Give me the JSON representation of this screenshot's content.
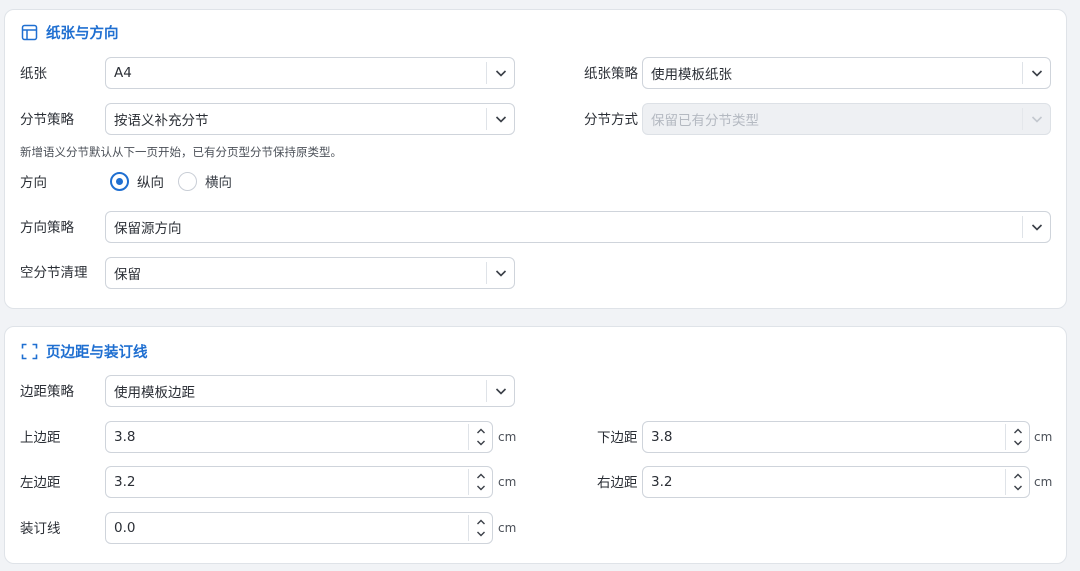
{
  "paper_section": {
    "title": "纸张与方向",
    "paper": {
      "label": "纸张",
      "value": "A4"
    },
    "paper_policy": {
      "label": "纸张策略",
      "value": "使用模板纸张"
    },
    "section_policy": {
      "label": "分节策略",
      "value": "按语义补充分节"
    },
    "section_mode": {
      "label": "分节方式",
      "value": "保留已有分节类型"
    },
    "hint": "新增语义分节默认从下一页开始，已有分页型分节保持原类型。",
    "orientation": {
      "label": "方向",
      "options": [
        {
          "label": "纵向",
          "checked": true
        },
        {
          "label": "横向",
          "checked": false
        }
      ]
    },
    "orientation_policy": {
      "label": "方向策略",
      "value": "保留源方向"
    },
    "empty_section_cleanup": {
      "label": "空分节清理",
      "value": "保留"
    }
  },
  "margin_section": {
    "title": "页边距与装订线",
    "margin_policy": {
      "label": "边距策略",
      "value": "使用模板边距"
    },
    "top": {
      "label": "上边距",
      "value": "3.8",
      "unit": "cm"
    },
    "bottom": {
      "label": "下边距",
      "value": "3.8",
      "unit": "cm"
    },
    "left": {
      "label": "左边距",
      "value": "3.2",
      "unit": "cm"
    },
    "right": {
      "label": "右边距",
      "value": "3.2",
      "unit": "cm"
    },
    "gutter": {
      "label": "装订线",
      "value": "0.0",
      "unit": "cm"
    }
  },
  "colors": {
    "accent": "#1f6fd1",
    "background": "#f1f3f6",
    "card": "#ffffff",
    "border": "#cfd4db",
    "disabled_bg": "#eef0f3"
  },
  "icons": {
    "paper_section": "layout-icon",
    "margin_section": "margin-frame-icon",
    "select": "chevron-down-icon",
    "stepper": "stepper-icon"
  }
}
